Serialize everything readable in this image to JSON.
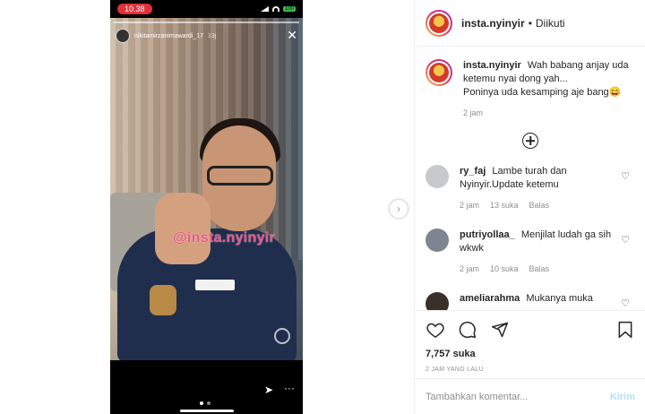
{
  "story": {
    "status_time": "10.38",
    "battery": "100",
    "username": "nikitamirzanimawardi_17",
    "time": "13j",
    "watermark": "@insta.nyinyir"
  },
  "post": {
    "username": "insta.nyinyir",
    "follow_label": "Diikuti",
    "caption_line1": "Wah babang anjay uda ketemu nyai dong yah...",
    "caption_line2": "Poninya uda kesamping aje bang😄",
    "caption_time": "2 jam",
    "likes": "7,757 suka",
    "posted_ago": "2 JAM YANG LALU"
  },
  "comments": [
    {
      "user": "ry_faj",
      "text": "Lambe turah dan Nyinyir.Update ketemu",
      "time": "2 jam",
      "likes": "13 suka",
      "reply": "Balas"
    },
    {
      "user": "putriyollaa_",
      "text": "Menjilat ludah ga sih wkwk",
      "time": "2 jam",
      "likes": "10 suka",
      "reply": "Balas"
    },
    {
      "user": "ameliarahma",
      "text": "Mukanya muka",
      "time": "",
      "likes": "",
      "reply": ""
    }
  ],
  "comment_box": {
    "placeholder": "Tambahkan komentar...",
    "post_label": "Kirim"
  },
  "icons": {
    "like": "heart-icon",
    "comment": "comment-icon",
    "share": "share-icon",
    "save": "bookmark-icon",
    "load_more": "plus-circle-icon",
    "next": "chevron-right-icon"
  },
  "colors": {
    "time_pill": "#e0313b",
    "post_button": "#b2dffc",
    "watermark": "#e63c78"
  }
}
